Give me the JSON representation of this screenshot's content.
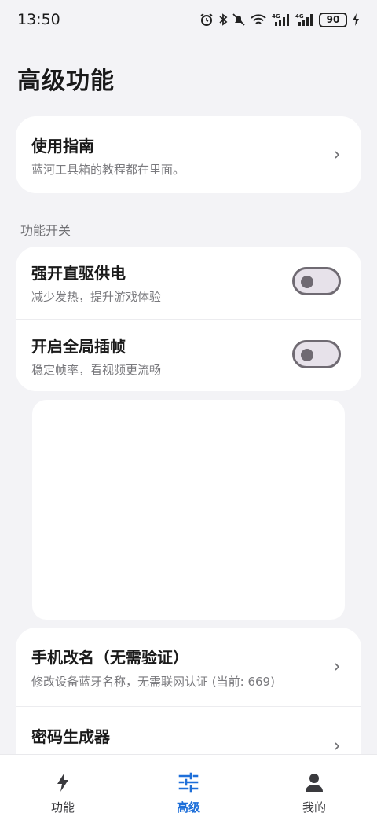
{
  "status": {
    "time": "13:50",
    "battery": "90"
  },
  "page": {
    "title": "高级功能"
  },
  "guide": {
    "title": "使用指南",
    "subtitle": "蓝河工具箱的教程都在里面。"
  },
  "section": {
    "label": "功能开关"
  },
  "toggles": [
    {
      "title": "强开直驱供电",
      "subtitle": "减少发热，提升游戏体验",
      "on": false
    },
    {
      "title": "开启全局插帧",
      "subtitle": "稳定帧率，看视频更流畅",
      "on": false
    }
  ],
  "tools": [
    {
      "title": "手机改名（无需验证）",
      "subtitle": "修改设备蓝牙名称，无需联网认证 (当前: 669)"
    },
    {
      "title": "密码生成器"
    }
  ],
  "nav": {
    "items": [
      {
        "label": "功能",
        "icon": "bolt-icon",
        "active": false
      },
      {
        "label": "高级",
        "icon": "sliders-icon",
        "active": true
      },
      {
        "label": "我的",
        "icon": "person-icon",
        "active": false
      }
    ],
    "accent": "#1e6fd9"
  }
}
